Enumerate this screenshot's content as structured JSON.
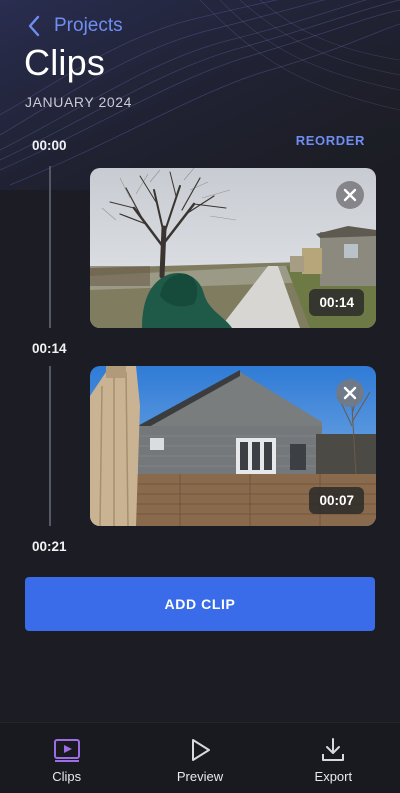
{
  "header": {
    "back_label": "Projects",
    "title": "Clips",
    "subtitle": "JANUARY 2024",
    "reorder_label": "REORDER"
  },
  "timeline": {
    "markers": [
      "00:00",
      "00:14",
      "00:21"
    ]
  },
  "clips": [
    {
      "duration": "00:14",
      "thumbnail": "winter tree and sidewalk with person in green hood"
    },
    {
      "duration": "00:07",
      "thumbnail": "house with wooden fence and patio umbrella"
    }
  ],
  "add_clip_label": "ADD CLIP",
  "nav": {
    "items": [
      {
        "label": "Clips",
        "icon": "clips-icon",
        "active": true
      },
      {
        "label": "Preview",
        "icon": "play-icon",
        "active": false
      },
      {
        "label": "Export",
        "icon": "download-icon",
        "active": false
      }
    ]
  },
  "colors": {
    "background": "#1c1d24",
    "accent": "#6f8ef2",
    "button": "#3a6ce9",
    "active_icon": "#9b6ee6"
  }
}
